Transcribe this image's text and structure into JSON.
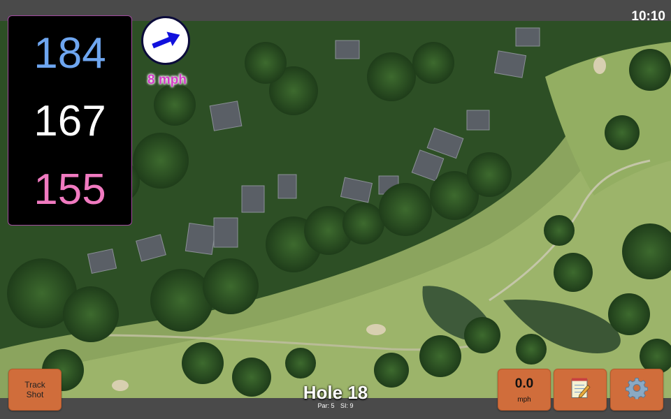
{
  "status": {
    "time": "10:10"
  },
  "distances": {
    "back": "184",
    "middle": "167",
    "front": "155"
  },
  "wind": {
    "speed_label": "8 mph",
    "direction_icon": "wind-arrow-icon"
  },
  "hole": {
    "title": "Hole 18",
    "par_label": "Par: 5",
    "si_label": "SI: 9"
  },
  "buttons": {
    "track_shot_label": "Track\nShot",
    "speed_value": "0.0",
    "speed_unit": "mph",
    "notes_icon": "notepad-icon",
    "settings_icon": "gear-icon"
  },
  "colors": {
    "back_distance": "#6ea6f0",
    "middle_distance": "#ffffff",
    "front_distance": "#f07ac0",
    "button": "#d06d3b",
    "wind_label": "#d43ec8",
    "accent_border": "#a24aa0"
  }
}
